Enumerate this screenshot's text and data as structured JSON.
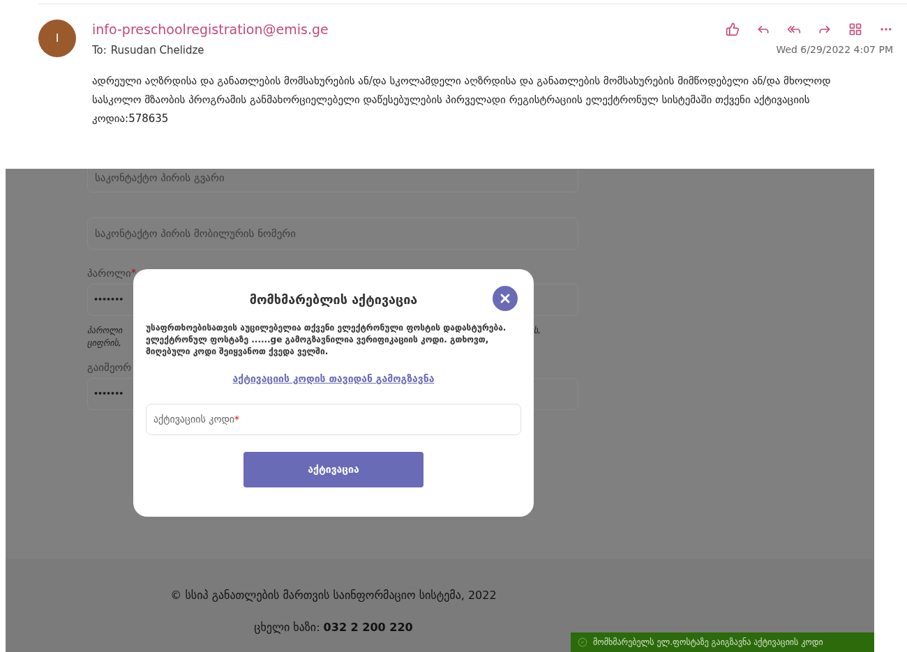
{
  "email": {
    "sender_initial": "I",
    "sender": "info-preschoolregistration@emis.ge",
    "to_label": "To:",
    "to": "Rusudan Chelidze",
    "date": "Wed 6/29/2022 4:07 PM",
    "body": "ადრეული აღზრდისა და განათლების მომსახურების ან/და სკოლამდელი აღზრდისა და განათლების მომსახურების მიმწოდებელი ან/და მხოლოდ სასკოლო მზაობის პროგრამის განმახორციელებელი დაწესებულების პირველადი რეგისტრაციის ელექტრონულ სისტემაში თქვენი აქტივაციის კოდია:578635"
  },
  "required_mark": "*",
  "form": [
    {
      "kind": "cut_field",
      "placeholder": "საკონტაქტო პირის გვარი"
    },
    {
      "kind": "field",
      "placeholder": "საკონტაქტო პირის მობილურის ნომერი"
    },
    {
      "kind": "label",
      "text": "პაროლი",
      "required": true
    },
    {
      "kind": "password",
      "value": "•••••••"
    },
    {
      "kind": "hint",
      "lines": [
        "პაროლი",
        "ციფრის,"
      ],
      "right": "ს,"
    },
    {
      "kind": "label",
      "text": "გაიმეორ",
      "required": false
    },
    {
      "kind": "password",
      "value": "•••••••"
    }
  ],
  "modal": {
    "title": "მომხმარებლის აქტივაცია",
    "message": "უსაფრთხოებისათვის აუცილებელია თქვენი ელექტრონული ფოსტის დადასტურება. ელექტრონულ ფოსტაზე ......ge გამოგზავნილია ვერიფიკაციის კოდი. გთხოვთ, მიღებული კოდი შეიყვანოთ ქვედა ველში.",
    "resend_link": "აქტივაციის კოდის თავიდან გამოგზავნა",
    "code_field": {
      "placeholder": "აქტივაციის კოდი",
      "required": true
    },
    "submit": "აქტივაცია"
  },
  "footer": {
    "copyright": "© სსიპ განათლების მართვის საინფორმაციო სისტემა, 2022",
    "hotline": "ცხელი ხაზი: **032 2 200 220**"
  },
  "toast": {
    "text": "მომხმარებელს ელ.ფოსტაზე გაიგზავნა აქტივაციის კოდი"
  }
}
